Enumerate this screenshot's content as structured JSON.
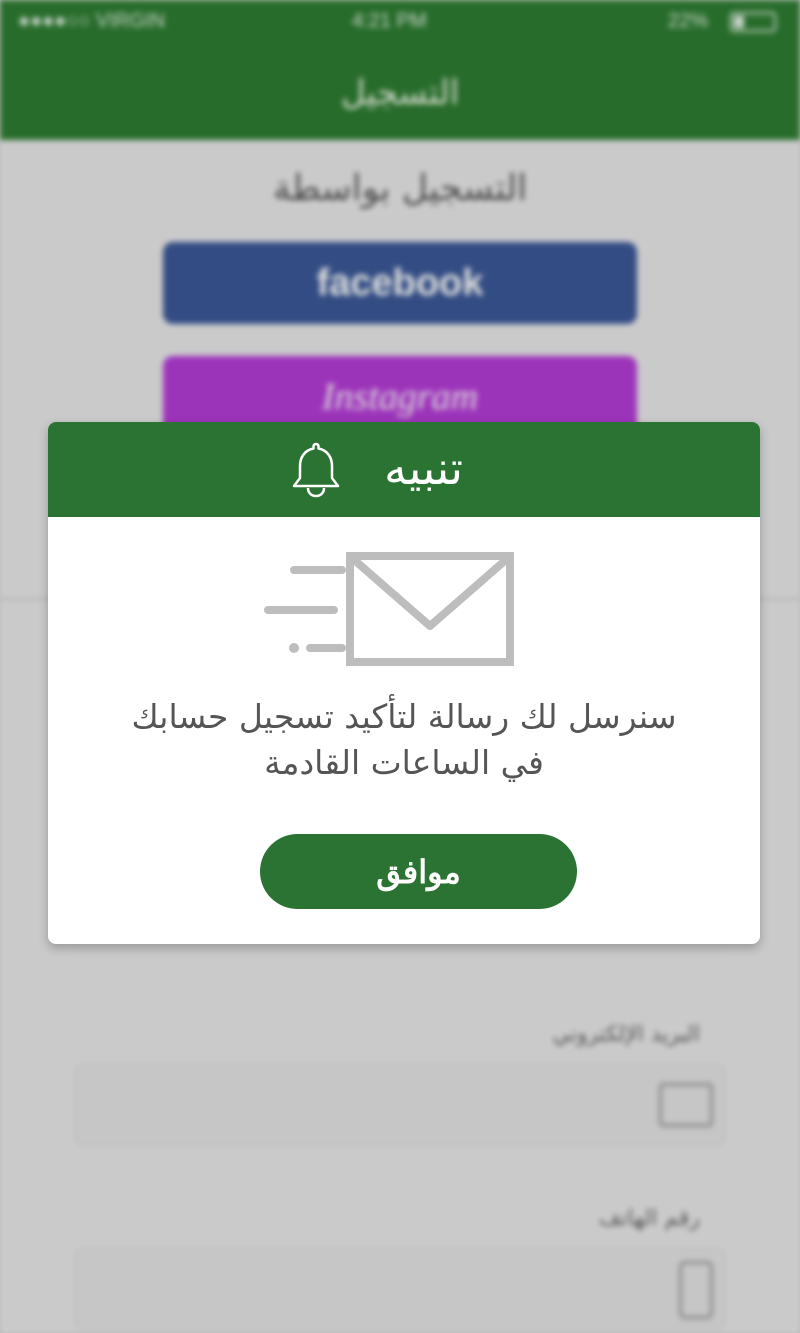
{
  "status_bar": {
    "carrier": "●●●●○○ VIRGIN",
    "time": "4:21 PM",
    "battery": "22%"
  },
  "header": {
    "title": "التسجيل"
  },
  "background": {
    "register_via": "التسجيل بواسطة",
    "facebook_label": "facebook",
    "instagram_label": "Instagram",
    "email_label": "البريد الإلكتروني",
    "phone_label": "رقم الهاتف"
  },
  "dialog": {
    "title": "تنبيه",
    "message_line1": "سنرسل لك رسالة لتأكيد تسجيل حسابك",
    "message_line2": "في الساعات القادمة",
    "ok_label": "موافق",
    "icons": [
      "bell-icon",
      "mail-icon"
    ]
  },
  "colors": {
    "primary_green": "#2a7332",
    "facebook_blue": "#3b5998",
    "instagram_purple": "#b43cd6",
    "text_gray": "#555555"
  }
}
